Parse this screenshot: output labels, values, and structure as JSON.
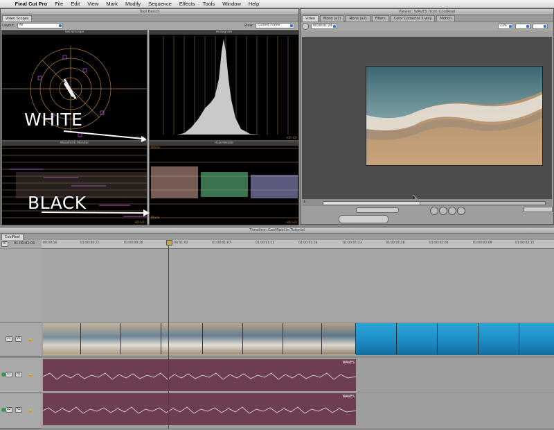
{
  "menubar": {
    "app_name": "Final Cut Pro",
    "items": [
      "File",
      "Edit",
      "View",
      "Mark",
      "Modify",
      "Sequence",
      "Effects",
      "Tools",
      "Window",
      "Help"
    ]
  },
  "toolbench": {
    "window_title": "Tool Bench",
    "tab": "Video Scopes",
    "layout_label": "Layout:",
    "layout_value": "All",
    "view_label": "View:",
    "view_value": "Current Frame",
    "scopes": {
      "vectorscope": "Vectorscope",
      "histogram": "Histogram",
      "waveform": "Waveform Monitor",
      "parade": "RGB Parade"
    },
    "hd_label": "HD (x2)",
    "histogram_ticks": [
      "-5",
      "0",
      "5",
      "10",
      "15",
      "20",
      "25",
      "30",
      "35",
      "40",
      "45",
      "50",
      "55",
      "60",
      "65",
      "70",
      "75",
      "80",
      "85",
      "90",
      "95",
      "100",
      "105",
      "110"
    ],
    "waveform_ticks": [
      "White",
      "100",
      "90",
      "80",
      "70",
      "60",
      "50",
      "40",
      "30",
      "20",
      "10",
      "Black"
    ],
    "parade_white": "White",
    "parade_black": "Black"
  },
  "annotations": {
    "white": "WHITE",
    "black": "BLACK"
  },
  "viewer": {
    "window_title": "Viewer: WAVES from CoolReel",
    "tabs": [
      "Video",
      "Mono (a1)",
      "Mono (a2)",
      "Filters",
      "Color Corrector 3-way",
      "Motion"
    ],
    "timecode": "00:00:01:24",
    "zoom": "23%",
    "scrub_start": "1"
  },
  "timeline": {
    "window_title": "Timeline: CoolReel in Tutorial",
    "tab": "CoolReel",
    "rt_label": "RT",
    "timecode": "01:00:01:01",
    "ruler": [
      "00:00:16",
      "01:00:00:21",
      "01:00:00:26",
      "01:00:01:02",
      "01:00:01:07",
      "01:00:01:12",
      "01:00:01:18",
      "01:00:01:23",
      "01:00:01:28",
      "01:00:02:04",
      "01:00:02:09",
      "01:00:02:15"
    ],
    "tracks": {
      "video": {
        "src": "v1",
        "dst": "V1"
      },
      "audio1": {
        "src": "a1",
        "dst": "A1",
        "clip": "WAVES"
      },
      "audio2": {
        "src": "a2",
        "dst": "A2",
        "clip": "WAVES"
      }
    }
  },
  "colors": {
    "scope_grid": "#b6813a",
    "audio_clip": "#6e3d52",
    "video_clip_a": "#9aa8b4",
    "video_clip_b": "#1f8fc9"
  }
}
